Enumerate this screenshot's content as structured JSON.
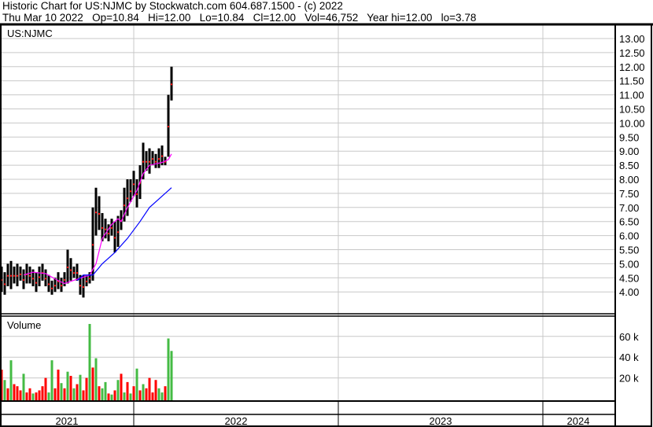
{
  "header": {
    "title": "Historic Chart for US:NJMC by Stockwatch.com 604.687.1500 - (c) 2022",
    "quote": "Thu Mar 10 2022   Op=10.84   Hi=12.00   Lo=10.84   Cl=12.00   Vol=46,752   Year hi=12.00   lo=3.78"
  },
  "chart_data": {
    "type": "candlestick",
    "symbol": "US:NJMC",
    "price_axis": {
      "min": 4.0,
      "max": 13.0,
      "step": 0.5,
      "ticks": [
        "13.00",
        "12.50",
        "12.00",
        "11.50",
        "11.00",
        "10.50",
        "10.00",
        "9.50",
        "9.00",
        "8.50",
        "8.00",
        "7.50",
        "7.00",
        "6.50",
        "6.00",
        "5.50",
        "5.00",
        "4.50",
        "4.00"
      ]
    },
    "volume_label": "Volume",
    "volume_axis": {
      "ticks": [
        {
          "value": 60,
          "label": "60 k"
        },
        {
          "value": 40,
          "label": "40 k"
        },
        {
          "value": 20,
          "label": "20 k"
        }
      ]
    },
    "x_axis": {
      "years": [
        "2021",
        "2022",
        "2023",
        "2024"
      ]
    },
    "price_bars": [
      [
        4.0,
        4.9
      ],
      [
        3.9,
        4.7
      ],
      [
        4.2,
        5.0
      ],
      [
        4.1,
        5.1
      ],
      [
        4.3,
        4.9
      ],
      [
        4.2,
        5.0
      ],
      [
        4.4,
        4.9
      ],
      [
        4.1,
        4.8
      ],
      [
        4.3,
        5.0
      ],
      [
        4.3,
        4.9
      ],
      [
        4.2,
        4.8
      ],
      [
        4.0,
        4.7
      ],
      [
        4.2,
        4.9
      ],
      [
        4.4,
        5.0
      ],
      [
        4.2,
        4.8
      ],
      [
        4.0,
        4.6
      ],
      [
        3.9,
        4.4
      ],
      [
        4.0,
        4.5
      ],
      [
        4.1,
        4.7
      ],
      [
        4.0,
        4.5
      ],
      [
        4.2,
        4.7
      ],
      [
        4.3,
        5.5
      ],
      [
        4.4,
        5.2
      ],
      [
        4.5,
        4.9
      ],
      [
        4.4,
        5.0
      ],
      [
        3.9,
        4.6
      ],
      [
        3.8,
        4.6
      ],
      [
        4.2,
        4.6
      ],
      [
        4.3,
        4.7
      ],
      [
        4.4,
        7.0
      ],
      [
        6.0,
        7.7
      ],
      [
        6.2,
        7.4
      ],
      [
        5.8,
        6.8
      ],
      [
        5.9,
        6.6
      ],
      [
        5.8,
        6.4
      ],
      [
        6.0,
        6.6
      ],
      [
        5.4,
        6.5
      ],
      [
        5.6,
        6.7
      ],
      [
        6.2,
        6.9
      ],
      [
        6.5,
        7.7
      ],
      [
        6.7,
        8.0
      ],
      [
        7.2,
        8.0
      ],
      [
        7.4,
        8.3
      ],
      [
        7.0,
        8.0
      ],
      [
        7.3,
        8.5
      ],
      [
        8.0,
        9.3
      ],
      [
        8.3,
        9.0
      ],
      [
        8.2,
        9.1
      ],
      [
        8.5,
        9.0
      ],
      [
        8.4,
        8.9
      ],
      [
        8.4,
        9.1
      ],
      [
        8.5,
        9.2
      ],
      [
        8.5,
        8.8
      ],
      [
        8.8,
        11.0
      ],
      [
        10.8,
        12.0
      ]
    ],
    "ma_fast": {
      "color": "#ff00ff",
      "points": [
        [
          7,
          4.6
        ],
        [
          10,
          4.7
        ],
        [
          14,
          4.65
        ],
        [
          18,
          4.4
        ],
        [
          20,
          4.3
        ],
        [
          24,
          4.45
        ],
        [
          28,
          4.6
        ],
        [
          30,
          5.0
        ],
        [
          32,
          5.9
        ],
        [
          35,
          6.4
        ],
        [
          37,
          6.6
        ],
        [
          38,
          6.5
        ],
        [
          40,
          7.0
        ],
        [
          43,
          7.6
        ],
        [
          45,
          8.2
        ],
        [
          47,
          8.5
        ],
        [
          51,
          8.6
        ],
        [
          53,
          8.7
        ],
        [
          54,
          8.9
        ]
      ]
    },
    "ma_slow": {
      "color": "#0000ff",
      "points": [
        [
          24,
          4.4
        ],
        [
          26,
          4.6
        ],
        [
          29,
          4.6
        ],
        [
          32,
          5.0
        ],
        [
          36,
          5.4
        ],
        [
          40,
          5.9
        ],
        [
          44,
          6.5
        ],
        [
          47,
          7.0
        ],
        [
          51,
          7.4
        ],
        [
          54,
          7.7
        ]
      ]
    },
    "volume_k": [
      28,
      18,
      10,
      37,
      14,
      12,
      8,
      24,
      6,
      10,
      5,
      6,
      8,
      12,
      20,
      6,
      37,
      10,
      28,
      15,
      10,
      26,
      22,
      10,
      14,
      23,
      8,
      20,
      72,
      30,
      39,
      12,
      10,
      16,
      5,
      4,
      8,
      18,
      24,
      6,
      16,
      5,
      12,
      29,
      8,
      14,
      10,
      20,
      6,
      18,
      10,
      6,
      12,
      58,
      46
    ],
    "volume_up": [
      0,
      1,
      0,
      1,
      0,
      0,
      0,
      1,
      0,
      0,
      1,
      0,
      0,
      0,
      0,
      1,
      1,
      0,
      0,
      1,
      0,
      1,
      0,
      1,
      0,
      1,
      0,
      0,
      1,
      0,
      1,
      0,
      1,
      1,
      0,
      1,
      0,
      1,
      0,
      1,
      0,
      1,
      0,
      1,
      0,
      1,
      0,
      0,
      0,
      0,
      1,
      1,
      0,
      1,
      1
    ],
    "colors": {
      "up": "#44bb44",
      "down": "#ff0000",
      "grid": "#c8c8c8"
    }
  }
}
